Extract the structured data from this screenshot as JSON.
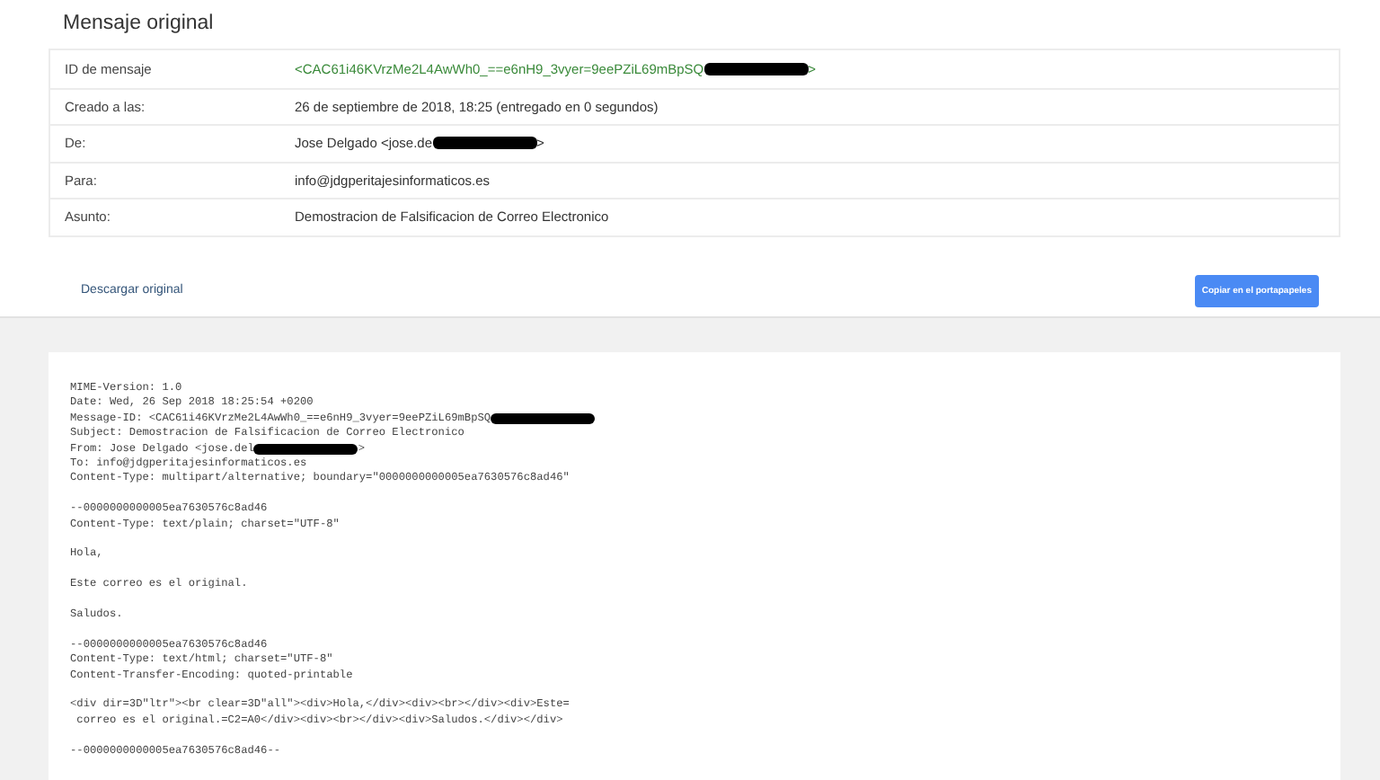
{
  "title": "Mensaje original",
  "details": [
    {
      "label": "ID de mensaje",
      "value": "<CAC61i46KVrzMe2L4AwWh0_==e6nH9_3vyer=9eePZiL69mBpSQ",
      "redacted": true,
      "tail": ">",
      "kind": "link"
    },
    {
      "label": "Creado a las:",
      "value": "26 de septiembre de 2018, 18:25 (entregado en 0 segundos)",
      "redacted": false,
      "kind": "plain"
    },
    {
      "label": "De:",
      "value": "Jose Delgado <jose.de",
      "redacted": true,
      "tail": ">",
      "kind": "plain"
    },
    {
      "label": "Para:",
      "value": "info@jdgperitajesinformaticos.es",
      "redacted": false,
      "kind": "plain"
    },
    {
      "label": "Asunto:",
      "value": "Demostracion de Falsificacion de Correo Electronico",
      "redacted": false,
      "kind": "plain"
    }
  ],
  "download_link": "Descargar original",
  "copy_button": "Copiar en el portapapeles",
  "source_blocks": [
    [
      {
        "text": "MIME-Version: 1.0",
        "redacted": false
      },
      {
        "text": "Date: Wed, 26 Sep 2018 18:25:54 +0200",
        "redacted": false
      },
      {
        "text": "Message-ID: <CAC61i46KVrzMe2L4AwWh0_==e6nH9_3vyer=9eePZiL69mBpSQ",
        "redacted": true
      },
      {
        "text": "Subject: Demostracion de Falsificacion de Correo Electronico",
        "redacted": false
      },
      {
        "text": "From: Jose Delgado <jose.del",
        "redacted": true,
        "tail": ">"
      },
      {
        "text": "To: info@jdgperitajesinformaticos.es",
        "redacted": false
      },
      {
        "text": "Content-Type: multipart/alternative; boundary=\"0000000000005ea7630576c8ad46\"",
        "redacted": false
      }
    ],
    [
      {
        "text": "--0000000000005ea7630576c8ad46",
        "redacted": false
      },
      {
        "text": "Content-Type: text/plain; charset=\"UTF-8\"",
        "redacted": false
      }
    ],
    [
      {
        "text": "Hola,",
        "redacted": false
      }
    ],
    [
      {
        "text": "Este correo es el original.",
        "redacted": false
      }
    ],
    [
      {
        "text": "Saludos.",
        "redacted": false
      }
    ],
    [
      {
        "text": "--0000000000005ea7630576c8ad46",
        "redacted": false
      },
      {
        "text": "Content-Type: text/html; charset=\"UTF-8\"",
        "redacted": false
      },
      {
        "text": "Content-Transfer-Encoding: quoted-printable",
        "redacted": false
      }
    ],
    [
      {
        "text": "<div dir=3D\"ltr\"><br clear=3D\"all\"><div>Hola,</div><div><br></div><div>Este=",
        "redacted": false
      },
      {
        "text": " correo es el original.=C2=A0</div><div><br></div><div>Saludos.</div></div>",
        "redacted": false
      }
    ],
    [
      {
        "text": "--0000000000005ea7630576c8ad46--",
        "redacted": false
      }
    ]
  ]
}
